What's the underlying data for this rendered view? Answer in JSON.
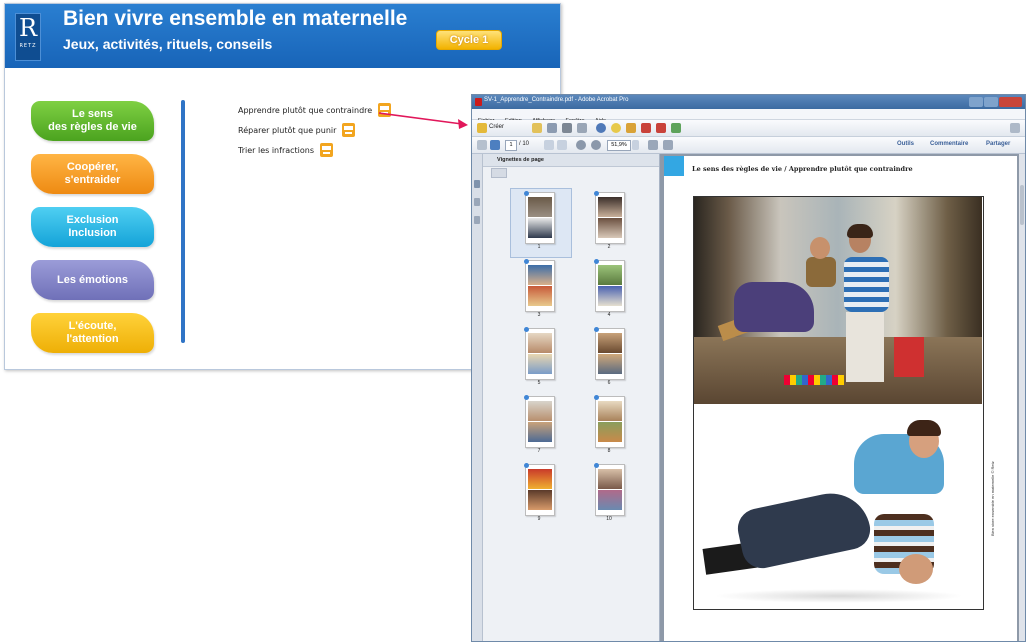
{
  "app": {
    "logo_letter": "R",
    "logo_text": "RETZ",
    "title": "Bien vivre ensemble en maternelle",
    "subtitle": "Jeux, activités, rituels, conseils",
    "cycle_badge": "Cycle 1",
    "colors": {
      "header": "#1f6fc3",
      "divider": "#2f74c6",
      "pdf_icon": "#f2a51f"
    },
    "categories": [
      {
        "label": "Le sens\ndes règles de vie",
        "color": "#5fb52f"
      },
      {
        "label": "Coopérer,\ns'entraider",
        "color": "#f39a1d"
      },
      {
        "label": "Exclusion\nInclusion",
        "color": "#1fb3e2"
      },
      {
        "label": "Les émotions",
        "color": "#7d7ec2"
      },
      {
        "label": "L'écoute,\nl'attention",
        "color": "#f2b90e"
      }
    ],
    "links": [
      {
        "label": "Apprendre plutôt que contraindre",
        "icon": "pdf-icon"
      },
      {
        "label": "Réparer plutôt que punir",
        "icon": "pdf-icon"
      },
      {
        "label": "Trier les infractions",
        "icon": "pdf-icon"
      }
    ],
    "arrow_color": "#e1175a"
  },
  "acrobat": {
    "window_title": "SV-1_Apprendre_Contraindre.pdf - Adobe Acrobat Pro",
    "menu": [
      "Fichier",
      "Edition",
      "Affichage",
      "Fenêtre",
      "Aide"
    ],
    "create_label": "Créer",
    "page_current": "1",
    "page_total": "/ 10",
    "zoom": "51,9%",
    "right_links": [
      "Outils",
      "Commentaire",
      "Partager"
    ],
    "panel_title": "Vignettes de page",
    "thumbnails": [
      "1",
      "2",
      "3",
      "4",
      "5",
      "6",
      "7",
      "8",
      "9",
      "10"
    ],
    "page_title": "Le sens des règles de vie / Apprendre plutôt que contraindre",
    "photo_credit": "Bien vivre ensemble en maternelle © Retz"
  }
}
